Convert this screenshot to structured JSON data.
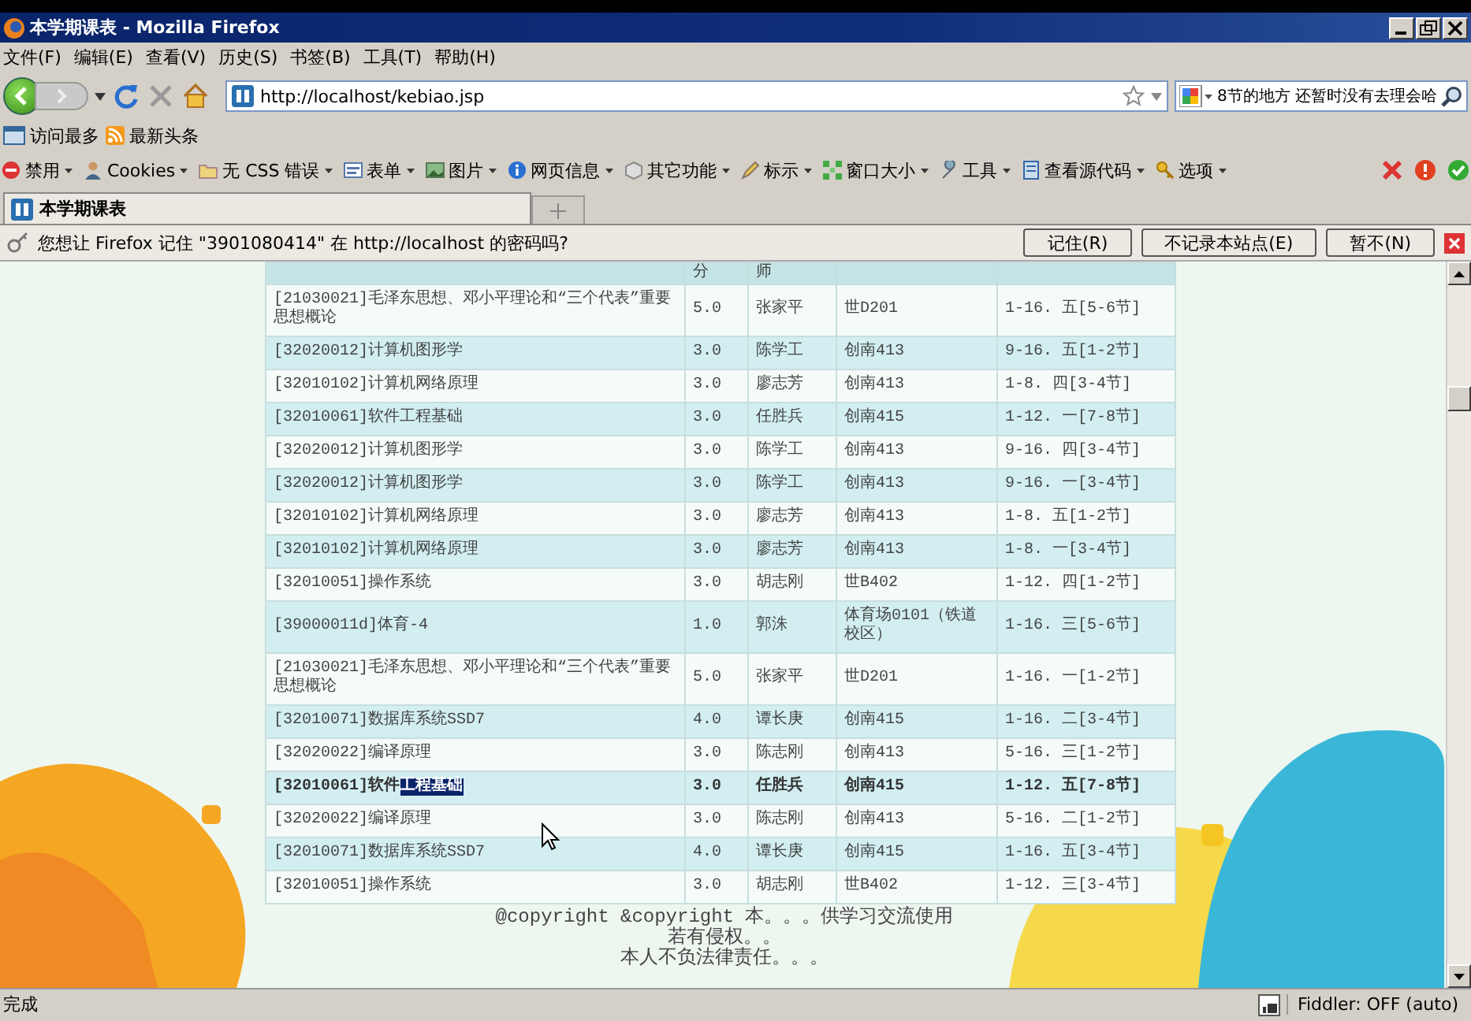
{
  "window": {
    "title": "本学期课表 - Mozilla Firefox"
  },
  "menu": [
    "文件(F)",
    "编辑(E)",
    "查看(V)",
    "历史(S)",
    "书签(B)",
    "工具(T)",
    "帮助(H)"
  ],
  "address_bar": {
    "value": "http://localhost/kebiao.jsp"
  },
  "search": {
    "value": "8节的地方 还暂时没有去理会哈"
  },
  "bookmarks": [
    "访问最多",
    "最新头条"
  ],
  "dev_toolbar": [
    {
      "label": "禁用",
      "kind": "stop"
    },
    {
      "label": "Cookies",
      "kind": "person"
    },
    {
      "label": "无 CSS 错误",
      "kind": "folder"
    },
    {
      "label": "表单",
      "kind": "form"
    },
    {
      "label": "图片",
      "kind": "image"
    },
    {
      "label": "网页信息",
      "kind": "info"
    },
    {
      "label": "其它功能",
      "kind": "cube"
    },
    {
      "label": "标示",
      "kind": "pen"
    },
    {
      "label": "窗口大小",
      "kind": "resize"
    },
    {
      "label": "工具",
      "kind": "wrench"
    },
    {
      "label": "查看源代码",
      "kind": "doc"
    },
    {
      "label": "选项",
      "kind": "key"
    }
  ],
  "tabs": [
    {
      "label": "本学期课表",
      "selected": true
    }
  ],
  "password_prompt": {
    "message": "您想让 Firefox 记住 \"3901080414\" 在 http://localhost 的密码吗?",
    "buttons": [
      "记住(R)",
      "不记录本站点(E)",
      "暂不(N)"
    ]
  },
  "table": {
    "columns": [
      "",
      "分",
      "师",
      "",
      ""
    ],
    "rows": [
      {
        "course": "[21030021]毛泽东思想、邓小平理论和“三个代表”重要思想概论",
        "credit": "5.0",
        "teacher": "张家平",
        "room": "世D201",
        "time": "1-16. 五[5-6节]",
        "hovered": false
      },
      {
        "course": "[32020012]计算机图形学",
        "credit": "3.0",
        "teacher": "陈学工",
        "room": "创南413",
        "time": "9-16. 五[1-2节]",
        "hovered": false
      },
      {
        "course": "[32010102]计算机网络原理",
        "credit": "3.0",
        "teacher": "廖志芳",
        "room": "创南413",
        "time": "1-8. 四[3-4节]",
        "hovered": false
      },
      {
        "course": "[32010061]软件工程基础",
        "credit": "3.0",
        "teacher": "任胜兵",
        "room": "创南415",
        "time": "1-12. 一[7-8节]",
        "hovered": false
      },
      {
        "course": "[32020012]计算机图形学",
        "credit": "3.0",
        "teacher": "陈学工",
        "room": "创南413",
        "time": "9-16. 四[3-4节]",
        "hovered": false
      },
      {
        "course": "[32020012]计算机图形学",
        "credit": "3.0",
        "teacher": "陈学工",
        "room": "创南413",
        "time": "9-16. 一[3-4节]",
        "hovered": false
      },
      {
        "course": "[32010102]计算机网络原理",
        "credit": "3.0",
        "teacher": "廖志芳",
        "room": "创南413",
        "time": "1-8. 五[1-2节]",
        "hovered": false
      },
      {
        "course": "[32010102]计算机网络原理",
        "credit": "3.0",
        "teacher": "廖志芳",
        "room": "创南413",
        "time": "1-8. 一[3-4节]",
        "hovered": false
      },
      {
        "course": "[32010051]操作系统",
        "credit": "3.0",
        "teacher": "胡志刚",
        "room": "世B402",
        "time": "1-12. 四[1-2节]",
        "hovered": false
      },
      {
        "course": "[39000011d]体育-4",
        "credit": "1.0",
        "teacher": "郭洙",
        "room": "体育场0101（铁道校区）",
        "time": "1-16. 三[5-6节]",
        "hovered": false
      },
      {
        "course": "[21030021]毛泽东思想、邓小平理论和“三个代表”重要思想概论",
        "credit": "5.0",
        "teacher": "张家平",
        "room": "世D201",
        "time": "1-16. 一[1-2节]",
        "hovered": false
      },
      {
        "course": "[32010071]数据库系统SSD7",
        "credit": "4.0",
        "teacher": "谭长庚",
        "room": "创南415",
        "time": "1-16. 二[3-4节]",
        "hovered": false
      },
      {
        "course": "[32020022]编译原理",
        "credit": "3.0",
        "teacher": "陈志刚",
        "room": "创南413",
        "time": "5-16. 三[1-2节]",
        "hovered": false
      },
      {
        "course": "[32010061]软件",
        "course_selected": "工程基础",
        "credit": "3.0",
        "teacher": "任胜兵",
        "room": "创南415",
        "time": "1-12. 五[7-8节]",
        "hovered": true
      },
      {
        "course": "[32020022]编译原理",
        "credit": "3.0",
        "teacher": "陈志刚",
        "room": "创南413",
        "time": "5-16. 二[1-2节]",
        "hovered": false
      },
      {
        "course": "[32010071]数据库系统SSD7",
        "credit": "4.0",
        "teacher": "谭长庚",
        "room": "创南415",
        "time": "1-16. 五[3-4节]",
        "hovered": false
      },
      {
        "course": "[32010051]操作系统",
        "credit": "3.0",
        "teacher": "胡志刚",
        "room": "世B402",
        "time": "1-12. 三[3-4节]",
        "hovered": false
      }
    ]
  },
  "footer": [
    "@copyright &copyright 本。。。供学习交流使用",
    "若有侵权。。",
    "本人不负法律责任。。。"
  ],
  "status_bar": {
    "text": "完成",
    "fiddler": "Fiddler: OFF (auto)"
  }
}
